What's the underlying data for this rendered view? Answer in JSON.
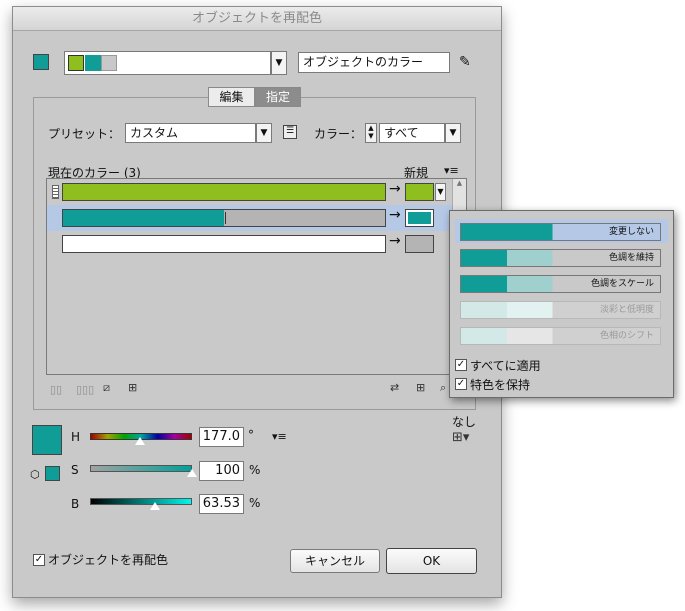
{
  "window": {
    "title": "オブジェクトを再配色"
  },
  "top": {
    "combo_field_value": "オブジェクトのカラー",
    "dropdown_arrow": "▼",
    "eyedropper": "✎"
  },
  "tabs": [
    {
      "label": "編集",
      "selected": false
    },
    {
      "label": "指定",
      "selected": true
    }
  ],
  "preset": {
    "label": "プリセット：",
    "value": "カスタム"
  },
  "colors_filter": {
    "label": "カラー：",
    "value": "すべて"
  },
  "current_colors": {
    "header": "現在のカラー (3)",
    "new_header": "新規",
    "menu_icon": "▾≡"
  },
  "rows": [
    {
      "current": "#8fbf1f",
      "new": "#8fbf1f",
      "arrow": "→",
      "selected": false
    },
    {
      "current": "#109c97",
      "new": "#109c97",
      "arrow": "→",
      "selected": true
    },
    {
      "current": "#ffffff",
      "new": "#b4b4b4",
      "arrow": "→",
      "selected": false
    }
  ],
  "popup": {
    "options": [
      {
        "label": "変更しない",
        "enabled": true,
        "selected": true
      },
      {
        "label": "色調を維持",
        "enabled": true,
        "selected": false
      },
      {
        "label": "色調をスケール",
        "enabled": true,
        "selected": false
      },
      {
        "label": "淡彩と低明度",
        "enabled": false,
        "selected": false
      },
      {
        "label": "色相のシフト",
        "enabled": false,
        "selected": false
      }
    ],
    "apply_all": {
      "label": "すべてに適用",
      "checked": true
    },
    "preserve_spot": {
      "label": "特色を保持",
      "checked": true
    }
  },
  "side": {
    "none_label": "なし"
  },
  "sliders": [
    {
      "label": "H",
      "value": "177.0",
      "unit": "°",
      "fraction": 0.49
    },
    {
      "label": "S",
      "value": "100",
      "unit": "%",
      "fraction": 1.0
    },
    {
      "label": "B",
      "value": "63.53",
      "unit": "%",
      "fraction": 0.64
    }
  ],
  "menu_icon": "▾≡",
  "bottom": {
    "recolor": {
      "label": "オブジェクトを再配色",
      "checked": true
    },
    "cancel": "キャンセル",
    "ok": "OK"
  },
  "colors": {
    "teal": "#109c97",
    "green": "#8fbf1f",
    "popup_selected": "#b5c8e6",
    "gray_bar": "#b4b4b4"
  }
}
